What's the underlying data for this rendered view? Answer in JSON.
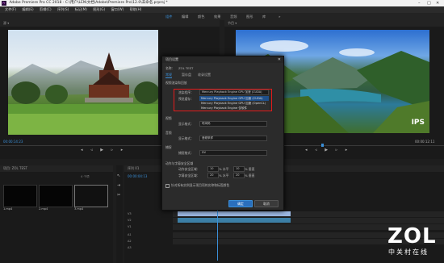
{
  "app": {
    "title": "Adobe Premiere Pro CC 2018 - C:\\用户\\LEN\\文档\\Adobe\\Premiere Pro\\12.0\\未命名.prproj *",
    "logo": "Pr"
  },
  "menu": [
    "文件(F)",
    "编辑(E)",
    "剪辑(C)",
    "序列(S)",
    "标记(M)",
    "图形(G)",
    "窗口(W)",
    "帮助(H)"
  ],
  "workspaces": [
    {
      "label": "组件",
      "active": true
    },
    {
      "label": "编辑",
      "active": false
    },
    {
      "label": "颜色",
      "active": false
    },
    {
      "label": "效果",
      "active": false
    },
    {
      "label": "音频",
      "active": false
    },
    {
      "label": "图形",
      "active": false
    },
    {
      "label": "库",
      "active": false
    }
  ],
  "source_monitor": {
    "timecode": "00:00:14:23",
    "right_timecode": "00:00:14:23"
  },
  "program_monitor": {
    "timecode": "00:00:04:13",
    "right_timecode": "00:00:12:11",
    "watermark": "IPS"
  },
  "dialog": {
    "title": "项目设置",
    "name_label": "名称：",
    "name_value": "ZOL TEST",
    "tabs": [
      "常规",
      "暂存盘",
      "收录设置"
    ],
    "section_render": "视频渲染和回放",
    "renderer_label": "渲染程序：",
    "renderer_value": "Mercury Playback Engine GPU 加速 (CUDA)",
    "preview_label": "预览缓存：",
    "options": [
      "Mercury Playback Engine GPU 加速 (CUDA)",
      "Mercury Playback Engine GPU 加速 (OpenCL)",
      "Mercury Playback Engine 仅软件"
    ],
    "section_video": "视频",
    "display_format_label": "显示格式：",
    "display_format_value": "时间码",
    "section_audio": "音频",
    "audio_format_label": "显示格式：",
    "audio_format_value": "音频采样",
    "section_capture": "捕捉",
    "capture_label": "捕捉格式：",
    "capture_value": "DV",
    "section_action": "动作与字幕安全区域",
    "action_safe_label": "动作安全区域：",
    "action_safe_h": "10",
    "action_safe_v": "10",
    "title_safe_label": "字幕安全区域：",
    "title_safe_h": "20",
    "title_safe_v": "20",
    "pct_h": "% 水平",
    "pct_v": "% 垂直",
    "checkbox_label": "针对所有实例显示项目项的名称和标签颜色",
    "ok_label": "确定",
    "cancel_label": "取消"
  },
  "project_panel": {
    "header": "项目: ZOL TEST",
    "items": [
      "1.mp4",
      "2.mp4",
      "3.mp4"
    ],
    "count": "4 个项"
  },
  "timeline": {
    "timecode": "00:00:04:13",
    "tracks": [
      "V3",
      "V2",
      "V1",
      "A1",
      "A2",
      "A3"
    ]
  },
  "brand": {
    "logo": "ZOL",
    "subtitle": "中关村在线"
  }
}
